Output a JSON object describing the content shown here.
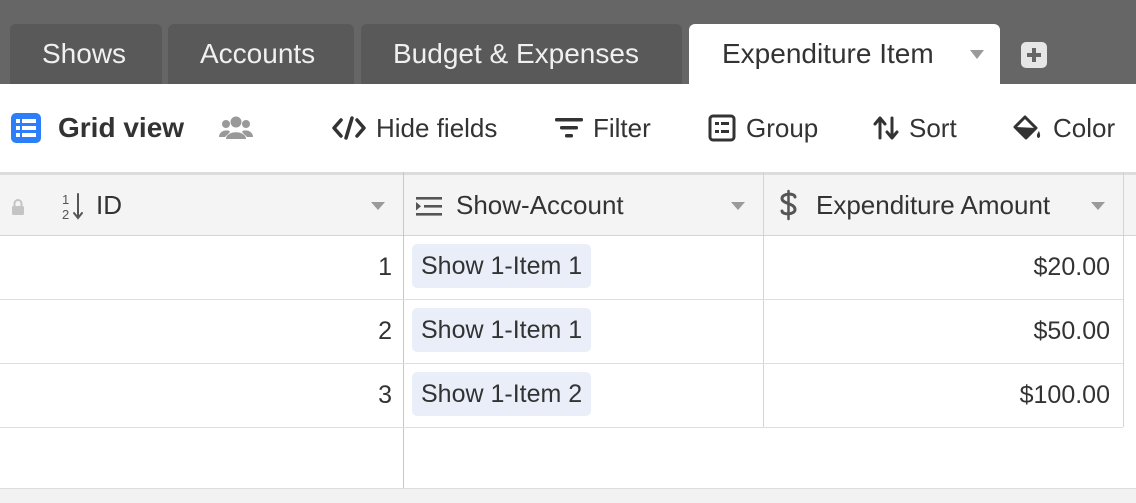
{
  "tabs": [
    {
      "label": "Shows",
      "active": false
    },
    {
      "label": "Accounts",
      "active": false
    },
    {
      "label": "Budget & Expenses",
      "active": false
    },
    {
      "label": "Expenditure Item",
      "active": true
    }
  ],
  "toolbar": {
    "view_name": "Grid view",
    "hide_fields": "Hide fields",
    "filter": "Filter",
    "group": "Group",
    "sort": "Sort",
    "color": "Color"
  },
  "icons": {
    "view": "grid-view-icon",
    "collaborators": "people-icon",
    "hide_fields": "code-slash-icon",
    "filter": "filter-lines-icon",
    "group": "group-box-icon",
    "sort": "sort-arrows-icon",
    "color": "paint-bucket-icon",
    "lock": "lock-icon",
    "id_field": "number-sort-icon",
    "link_field": "link-lines-icon",
    "currency_field": "dollar-icon"
  },
  "colors": {
    "accent": "#2d7ff9",
    "tabbar_bg": "#666666",
    "tab_bg": "#595959",
    "chip_bg": "#e9eef9"
  },
  "columns": [
    {
      "name": "ID"
    },
    {
      "name": "Show-Account"
    },
    {
      "name": "Expenditure Amount"
    }
  ],
  "rows": [
    {
      "id": "1",
      "show_account": "Show 1-Item 1",
      "amount": "$20.00"
    },
    {
      "id": "2",
      "show_account": "Show 1-Item 1",
      "amount": "$50.00"
    },
    {
      "id": "3",
      "show_account": "Show 1-Item 2",
      "amount": "$100.00"
    }
  ]
}
